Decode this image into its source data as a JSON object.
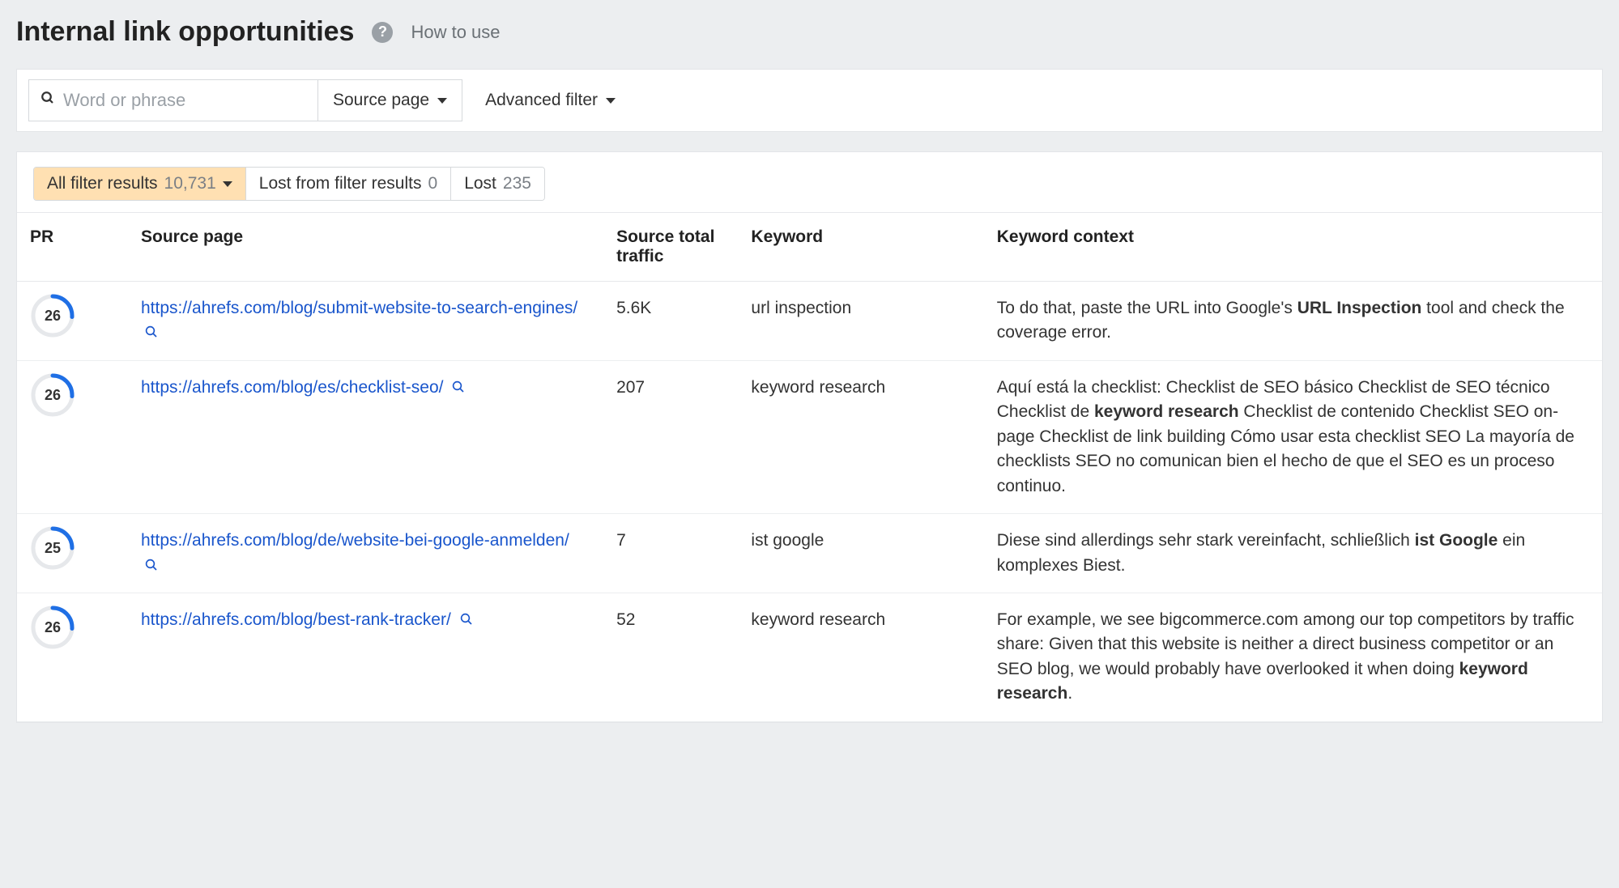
{
  "page": {
    "title": "Internal link opportunities",
    "how_to_use": "How to use"
  },
  "filters": {
    "search_placeholder": "Word or phrase",
    "source_page_label": "Source page",
    "advanced_filter_label": "Advanced filter"
  },
  "tabs": {
    "all": {
      "label": "All filter results",
      "count": "10,731"
    },
    "lost_filter": {
      "label": "Lost from filter results",
      "count": "0"
    },
    "lost": {
      "label": "Lost",
      "count": "235"
    }
  },
  "columns": {
    "pr": "PR",
    "source_page": "Source page",
    "traffic": "Source total traffic",
    "keyword": "Keyword",
    "context": "Keyword context"
  },
  "rows": [
    {
      "pr": 26,
      "pr_pct": 26,
      "url": "https://ahrefs.com/blog/submit-website-to-search-engines/",
      "traffic": "5.6K",
      "keyword": "url inspection",
      "context_pre": "To do that, paste the URL into Google's ",
      "context_bold": "URL Inspection",
      "context_post": " tool and check the coverage error."
    },
    {
      "pr": 26,
      "pr_pct": 26,
      "url": "https://ahrefs.com/blog/es/checklist-seo/",
      "traffic": "207",
      "keyword": "keyword research",
      "context_pre": "Aquí está la checklist: Checklist de SEO básico Checklist de SEO técnico Checklist de ",
      "context_bold": "keyword research",
      "context_post": " Checklist de contenido Checklist SEO on-page Checklist de link building Cómo usar esta checklist SEO La mayoría de checklists SEO no comunican bien el hecho de que el SEO es un proceso continuo."
    },
    {
      "pr": 25,
      "pr_pct": 25,
      "url": "https://ahrefs.com/blog/de/website-bei-google-anmelden/",
      "traffic": "7",
      "keyword": "ist google",
      "context_pre": "Diese sind allerdings sehr stark vereinfacht, schließlich ",
      "context_bold": "ist Google",
      "context_post": " ein komplexes Biest."
    },
    {
      "pr": 26,
      "pr_pct": 26,
      "url": "https://ahrefs.com/blog/best-rank-tracker/",
      "traffic": "52",
      "keyword": "keyword research",
      "context_pre": "For example, we see bigcommerce.com among our top competitors by traffic share: Given that this website is neither a direct business competitor or an SEO blog, we would probably have overlooked it when doing ",
      "context_bold": "keyword research",
      "context_post": "."
    }
  ]
}
